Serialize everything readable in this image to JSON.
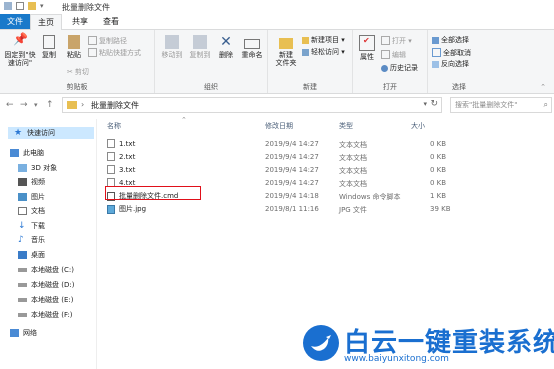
{
  "window": {
    "title": "批量删除文件"
  },
  "tabs": {
    "file": "文件",
    "home": "主页",
    "share": "共享",
    "view": "查看"
  },
  "ribbon": {
    "clipboard": {
      "label": "剪贴板",
      "pin": "固定到\"快\n速访问\"",
      "copy": "复制",
      "paste": "粘贴",
      "copy_path": "复制路径",
      "paste_shortcut": "粘贴快捷方式",
      "cut": "剪切"
    },
    "organize": {
      "label": "组织",
      "move_to": "移动到",
      "copy_to": "复制到",
      "delete": "删除",
      "rename": "重命名"
    },
    "new": {
      "label": "新建",
      "new_folder": "新建\n文件夹",
      "new_item": "新建项目 ▾",
      "easy_access": "轻松访问 ▾"
    },
    "open": {
      "label": "打开",
      "properties": "属性",
      "open": "打开 ▾",
      "edit": "编辑",
      "history": "历史记录"
    },
    "select": {
      "label": "选择",
      "select_all": "全部选择",
      "select_none": "全部取消",
      "invert": "反向选择"
    }
  },
  "address": {
    "path": "批量删除文件"
  },
  "search": {
    "placeholder": "搜索\"批量删除文件\""
  },
  "nav": {
    "quick_access": "快速访问",
    "this_pc": "此电脑",
    "items": [
      "3D 对象",
      "视频",
      "图片",
      "文档",
      "下载",
      "音乐",
      "桌面",
      "本地磁盘 (C:)",
      "本地磁盘 (D:)",
      "本地磁盘 (E:)",
      "本地磁盘 (F:)"
    ],
    "network": "网络"
  },
  "columns": {
    "name": "名称",
    "date": "修改日期",
    "type": "类型",
    "size": "大小"
  },
  "files": [
    {
      "name": "1.txt",
      "date": "2019/9/4 14:27",
      "type": "文本文档",
      "size": "0 KB",
      "icon": "txt"
    },
    {
      "name": "2.txt",
      "date": "2019/9/4 14:27",
      "type": "文本文档",
      "size": "0 KB",
      "icon": "txt"
    },
    {
      "name": "3.txt",
      "date": "2019/9/4 14:27",
      "type": "文本文档",
      "size": "0 KB",
      "icon": "txt"
    },
    {
      "name": "4.txt",
      "date": "2019/9/4 14:27",
      "type": "文本文档",
      "size": "0 KB",
      "icon": "txt"
    },
    {
      "name": "批量删除文件.cmd",
      "date": "2019/9/4 14:18",
      "type": "Windows 命令脚本",
      "size": "1 KB",
      "icon": "cmd"
    },
    {
      "name": "图片.jpg",
      "date": "2019/8/1 11:16",
      "type": "JPG 文件",
      "size": "39 KB",
      "icon": "jpg"
    }
  ],
  "watermark": {
    "text": "白云一键重装系统",
    "url": "www.baiyunxitong.com"
  }
}
